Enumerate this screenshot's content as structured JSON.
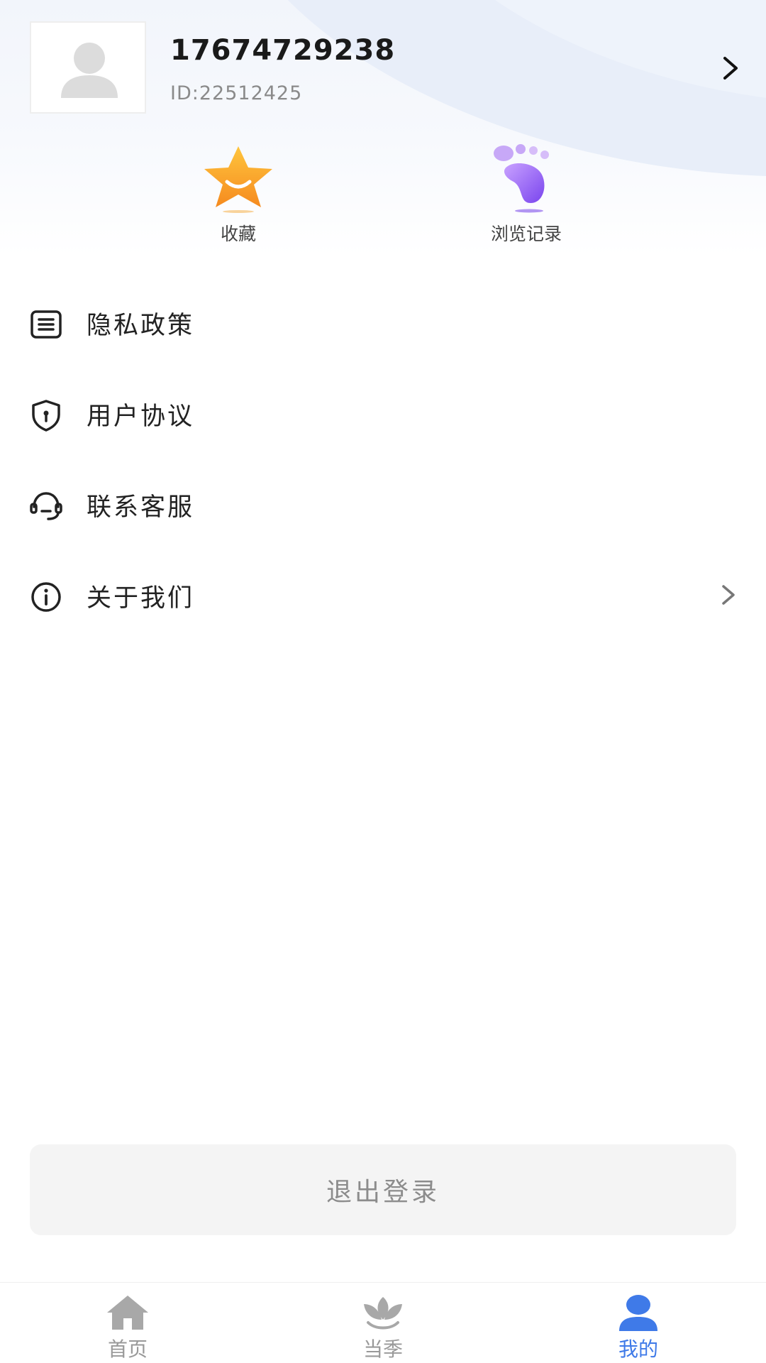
{
  "profile": {
    "phone": "17674729238",
    "id_text": "ID:22512425"
  },
  "quick_actions": [
    {
      "label": "收藏",
      "icon": "star-icon",
      "color": "#f7a12b"
    },
    {
      "label": "浏览记录",
      "icon": "footprint-icon",
      "color": "#8f5bf0"
    }
  ],
  "menu": [
    {
      "label": "隐私政策",
      "icon": "document-icon"
    },
    {
      "label": "用户协议",
      "icon": "shield-icon"
    },
    {
      "label": "联系客服",
      "icon": "headset-icon"
    },
    {
      "label": "关于我们",
      "icon": "info-icon"
    }
  ],
  "logout_label": "退出登录",
  "tabs": [
    {
      "label": "首页",
      "icon": "home-icon",
      "active": false
    },
    {
      "label": "当季",
      "icon": "lotus-icon",
      "active": false
    },
    {
      "label": "我的",
      "icon": "user-icon",
      "active": true
    }
  ],
  "colors": {
    "accent": "#3f7ae8",
    "inactive": "#999999"
  }
}
